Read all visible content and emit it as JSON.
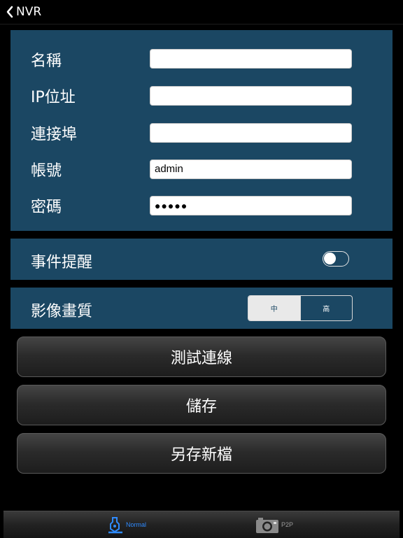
{
  "nav": {
    "back_label": "NVR"
  },
  "form": {
    "name_label": "名稱",
    "ip_label": "IP位址",
    "port_label": "連接埠",
    "account_label": "帳號",
    "password_label": "密碼",
    "name_value": "",
    "ip_value": "",
    "port_value": "",
    "account_value": "admin",
    "password_value": "●●●●●"
  },
  "event": {
    "label": "事件提醒",
    "enabled": false
  },
  "quality": {
    "label": "影像畫質",
    "options": [
      "中",
      "高"
    ],
    "selected": "中"
  },
  "buttons": {
    "test": "測試連線",
    "save": "儲存",
    "save_as": "另存新檔"
  },
  "tabs": [
    {
      "label": "Normal",
      "active": true,
      "icon": "pen-icon"
    },
    {
      "label": "P2P",
      "active": false,
      "icon": "camera-icon"
    }
  ],
  "colors": {
    "panel": "#1b4763",
    "active_tab": "#2f8bff"
  }
}
